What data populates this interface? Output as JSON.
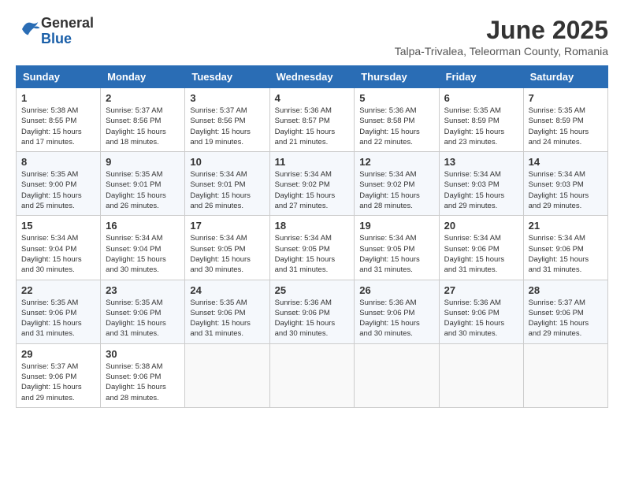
{
  "header": {
    "logo_line1": "General",
    "logo_line2": "Blue",
    "month_year": "June 2025",
    "location": "Talpa-Trivalea, Teleorman County, Romania"
  },
  "weekdays": [
    "Sunday",
    "Monday",
    "Tuesday",
    "Wednesday",
    "Thursday",
    "Friday",
    "Saturday"
  ],
  "weeks": [
    [
      {
        "day": "1",
        "info": "Sunrise: 5:38 AM\nSunset: 8:55 PM\nDaylight: 15 hours\nand 17 minutes."
      },
      {
        "day": "2",
        "info": "Sunrise: 5:37 AM\nSunset: 8:56 PM\nDaylight: 15 hours\nand 18 minutes."
      },
      {
        "day": "3",
        "info": "Sunrise: 5:37 AM\nSunset: 8:56 PM\nDaylight: 15 hours\nand 19 minutes."
      },
      {
        "day": "4",
        "info": "Sunrise: 5:36 AM\nSunset: 8:57 PM\nDaylight: 15 hours\nand 21 minutes."
      },
      {
        "day": "5",
        "info": "Sunrise: 5:36 AM\nSunset: 8:58 PM\nDaylight: 15 hours\nand 22 minutes."
      },
      {
        "day": "6",
        "info": "Sunrise: 5:35 AM\nSunset: 8:59 PM\nDaylight: 15 hours\nand 23 minutes."
      },
      {
        "day": "7",
        "info": "Sunrise: 5:35 AM\nSunset: 8:59 PM\nDaylight: 15 hours\nand 24 minutes."
      }
    ],
    [
      {
        "day": "8",
        "info": "Sunrise: 5:35 AM\nSunset: 9:00 PM\nDaylight: 15 hours\nand 25 minutes."
      },
      {
        "day": "9",
        "info": "Sunrise: 5:35 AM\nSunset: 9:01 PM\nDaylight: 15 hours\nand 26 minutes."
      },
      {
        "day": "10",
        "info": "Sunrise: 5:34 AM\nSunset: 9:01 PM\nDaylight: 15 hours\nand 26 minutes."
      },
      {
        "day": "11",
        "info": "Sunrise: 5:34 AM\nSunset: 9:02 PM\nDaylight: 15 hours\nand 27 minutes."
      },
      {
        "day": "12",
        "info": "Sunrise: 5:34 AM\nSunset: 9:02 PM\nDaylight: 15 hours\nand 28 minutes."
      },
      {
        "day": "13",
        "info": "Sunrise: 5:34 AM\nSunset: 9:03 PM\nDaylight: 15 hours\nand 29 minutes."
      },
      {
        "day": "14",
        "info": "Sunrise: 5:34 AM\nSunset: 9:03 PM\nDaylight: 15 hours\nand 29 minutes."
      }
    ],
    [
      {
        "day": "15",
        "info": "Sunrise: 5:34 AM\nSunset: 9:04 PM\nDaylight: 15 hours\nand 30 minutes."
      },
      {
        "day": "16",
        "info": "Sunrise: 5:34 AM\nSunset: 9:04 PM\nDaylight: 15 hours\nand 30 minutes."
      },
      {
        "day": "17",
        "info": "Sunrise: 5:34 AM\nSunset: 9:05 PM\nDaylight: 15 hours\nand 30 minutes."
      },
      {
        "day": "18",
        "info": "Sunrise: 5:34 AM\nSunset: 9:05 PM\nDaylight: 15 hours\nand 31 minutes."
      },
      {
        "day": "19",
        "info": "Sunrise: 5:34 AM\nSunset: 9:05 PM\nDaylight: 15 hours\nand 31 minutes."
      },
      {
        "day": "20",
        "info": "Sunrise: 5:34 AM\nSunset: 9:06 PM\nDaylight: 15 hours\nand 31 minutes."
      },
      {
        "day": "21",
        "info": "Sunrise: 5:34 AM\nSunset: 9:06 PM\nDaylight: 15 hours\nand 31 minutes."
      }
    ],
    [
      {
        "day": "22",
        "info": "Sunrise: 5:35 AM\nSunset: 9:06 PM\nDaylight: 15 hours\nand 31 minutes."
      },
      {
        "day": "23",
        "info": "Sunrise: 5:35 AM\nSunset: 9:06 PM\nDaylight: 15 hours\nand 31 minutes."
      },
      {
        "day": "24",
        "info": "Sunrise: 5:35 AM\nSunset: 9:06 PM\nDaylight: 15 hours\nand 31 minutes."
      },
      {
        "day": "25",
        "info": "Sunrise: 5:36 AM\nSunset: 9:06 PM\nDaylight: 15 hours\nand 30 minutes."
      },
      {
        "day": "26",
        "info": "Sunrise: 5:36 AM\nSunset: 9:06 PM\nDaylight: 15 hours\nand 30 minutes."
      },
      {
        "day": "27",
        "info": "Sunrise: 5:36 AM\nSunset: 9:06 PM\nDaylight: 15 hours\nand 30 minutes."
      },
      {
        "day": "28",
        "info": "Sunrise: 5:37 AM\nSunset: 9:06 PM\nDaylight: 15 hours\nand 29 minutes."
      }
    ],
    [
      {
        "day": "29",
        "info": "Sunrise: 5:37 AM\nSunset: 9:06 PM\nDaylight: 15 hours\nand 29 minutes."
      },
      {
        "day": "30",
        "info": "Sunrise: 5:38 AM\nSunset: 9:06 PM\nDaylight: 15 hours\nand 28 minutes."
      },
      {
        "day": "",
        "info": ""
      },
      {
        "day": "",
        "info": ""
      },
      {
        "day": "",
        "info": ""
      },
      {
        "day": "",
        "info": ""
      },
      {
        "day": "",
        "info": ""
      }
    ]
  ]
}
